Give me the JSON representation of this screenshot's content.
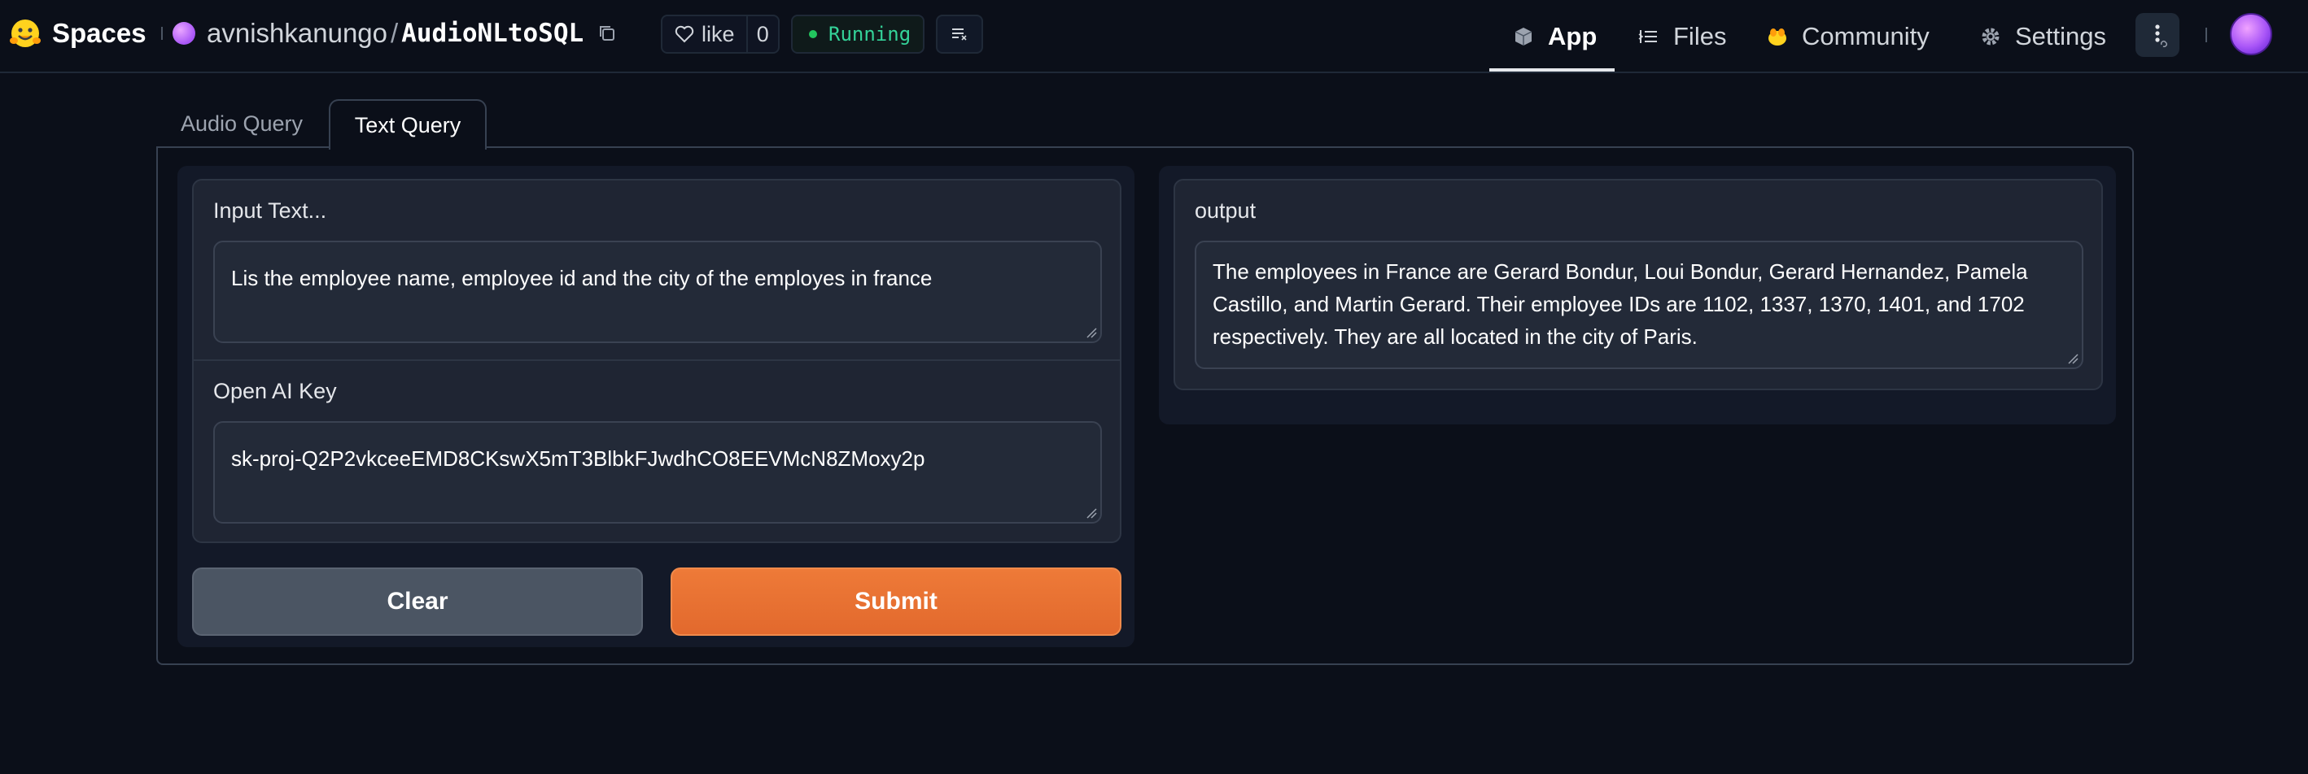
{
  "header": {
    "brand": "Spaces",
    "repo_owner": "avnishkanungo",
    "repo_separator": "/",
    "repo_name": "AudioNLtoSQL",
    "like_label": "like",
    "like_count": "0",
    "status": "Running",
    "status_color": "#22c55e",
    "nav": [
      {
        "label": "App",
        "icon": "cube-icon",
        "active": true
      },
      {
        "label": "Files",
        "icon": "files-icon",
        "active": false
      },
      {
        "label": "Community",
        "icon": "community-icon",
        "active": false
      },
      {
        "label": "Settings",
        "icon": "gear-icon",
        "active": false
      }
    ]
  },
  "tabs": [
    {
      "label": "Audio Query",
      "active": false
    },
    {
      "label": "Text Query",
      "active": true
    }
  ],
  "inputs": {
    "text_label": "Input Text...",
    "text_value": "Lis the employee name, employee id and the city of the employes in france",
    "key_label": "Open AI Key",
    "key_value": "sk-proj-Q2P2vkceeEMD8CKswX5mT3BlbkFJwdhCO8EEVMcN8ZMoxy2p"
  },
  "buttons": {
    "clear": "Clear",
    "submit": "Submit",
    "accent": "#e8702f"
  },
  "output": {
    "label": "output",
    "value": "The employees in France are Gerard Bondur, Loui Bondur, Gerard Hernandez, Pamela Castillo, and Martin Gerard. Their employee IDs are 1102, 1337, 1370, 1401, and 1702 respectively. They are all located in the city of Paris."
  }
}
